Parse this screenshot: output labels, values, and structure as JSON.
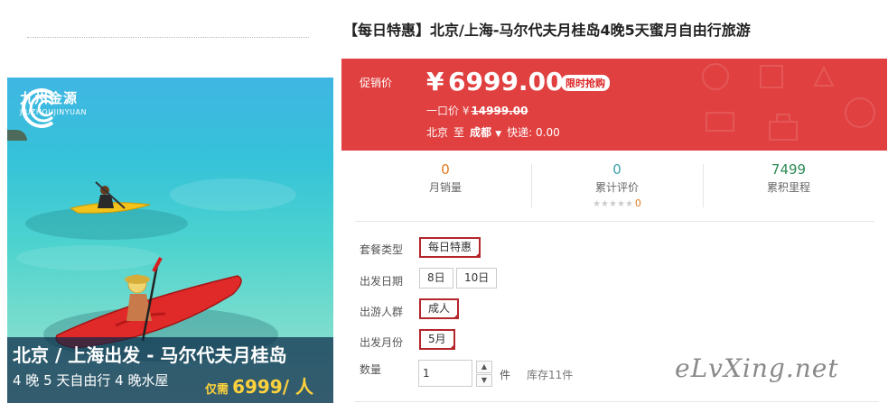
{
  "product": {
    "title": "【每日特惠】北京/上海-马尔代夫月桂岛4晚5天蜜月自由行旅游"
  },
  "image": {
    "logo_cn": "九州金源",
    "logo_en": "JIUZHOUJINYUAN",
    "caption_title": "北京 / 上海出发 - 马尔代夫月桂岛",
    "caption_sub": "4 晚 5 天自由行 4 晚水屋",
    "caption_price_prefix": "仅需",
    "caption_price": "6999/ 人"
  },
  "promo": {
    "label": "促销价",
    "currency": "¥",
    "price": "6999.00",
    "badge": "限时抢购",
    "orig_label": "一口价 ¥",
    "orig_price": "14999.00",
    "from": "北京",
    "to_word": "至",
    "dest": "成都",
    "shipping": "快递: 0.00",
    "bg_color": "#e14040"
  },
  "stats": [
    {
      "value": "0",
      "label": "月销量"
    },
    {
      "value": "0",
      "label": "累计评价",
      "stars": "★★★★★",
      "star_count": "0"
    },
    {
      "value": "7499",
      "label": "累积里程"
    }
  ],
  "options": {
    "package_label": "套餐类型",
    "package_value": "每日特惠",
    "date_label": "出发日期",
    "dates": [
      "8日",
      "10日"
    ],
    "crowd_label": "出游人群",
    "crowd_value": "成人",
    "month_label": "出发月份",
    "month_value": "5月",
    "qty_label": "数量",
    "qty_value": "1",
    "unit": "件",
    "stock": "库存11件"
  },
  "watermark": "eLvXing.net",
  "icons": [
    "chevron-down-icon",
    "increment-icon",
    "decrement-icon",
    "star-icon"
  ]
}
